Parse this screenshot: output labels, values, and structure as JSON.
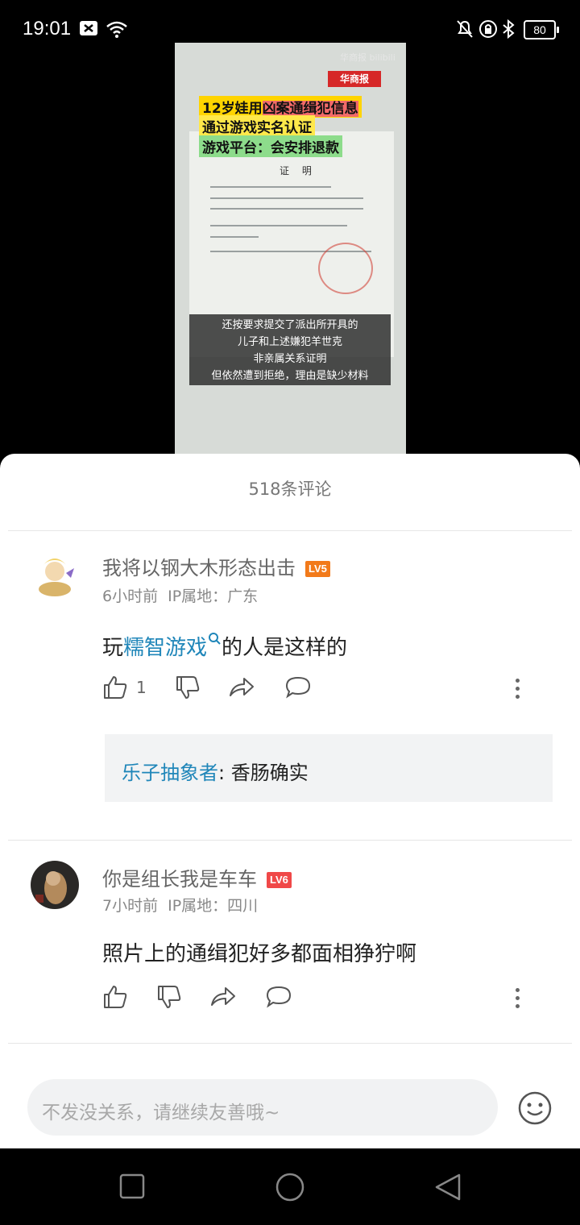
{
  "status_bar": {
    "time": "19:01",
    "battery": "80"
  },
  "video": {
    "watermark": "华商报 bilibili",
    "brand": "华商报",
    "headline_1a": "12岁娃用",
    "headline_1b": "凶案通缉犯信息",
    "headline_2": "通过游戏实名认证",
    "headline_3": "游戏平台：会安排退款",
    "doc_title": "证 明",
    "caption_lines": [
      "还按要求提交了派出所开具的",
      "儿子和上述嫌犯羊世克",
      "非亲属关系证明",
      "但依然遭到拒绝，理由是缺少材料"
    ]
  },
  "comments_sheet": {
    "title": "518条评论",
    "comments": [
      {
        "username": "我将以钢大木形态出击",
        "level": "LV5",
        "level_color": "#f27a1a",
        "time": "6小时前",
        "ip": "IP属地：广东",
        "text_prefix": "玩",
        "text_link": "糯智游戏",
        "text_suffix": "的人是这样的",
        "likes": "1",
        "reply": {
          "user": "乐子抽象者",
          "sep": ":",
          "text": " 香肠确实"
        }
      },
      {
        "username": "你是组长我是车车",
        "level": "LV6",
        "level_color": "#f04848",
        "time": "7小时前",
        "ip": "IP属地：四川",
        "text": "照片上的通缉犯好多都面相狰狞啊"
      }
    ]
  },
  "input": {
    "placeholder": "不发没关系，请继续友善哦~"
  }
}
